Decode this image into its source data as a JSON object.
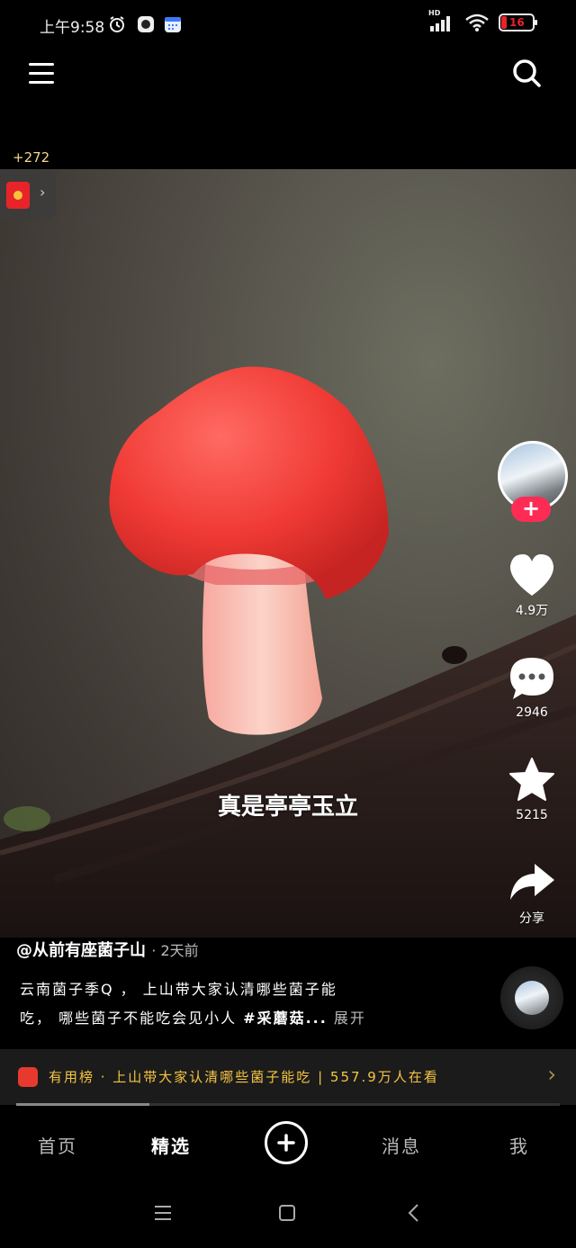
{
  "status_bar": {
    "time": "上午9:58",
    "network": "HD",
    "battery": "16",
    "icons": [
      "alarm-icon",
      "app-icon",
      "calendar-icon",
      "signal-icon",
      "wifi-icon",
      "battery-icon"
    ]
  },
  "top_nav": {
    "menu_icon": "menu-icon",
    "search_icon": "search-icon"
  },
  "coin_count": "+272",
  "video": {
    "subtitle": "真是亭亭玉立"
  },
  "actions": {
    "likes": "4.9万",
    "comments": "2946",
    "favorites": "5215",
    "share": "分享",
    "follow_label": "+"
  },
  "caption": {
    "author": "@从前有座菌子山",
    "time": "· 2天前",
    "desc_line1": "云南菌子季Q ， 上山带大家认清哪些菌子能",
    "desc_line2_text": "吃， 哪些菌子不能吃会见小人 ",
    "desc_tag": "#采蘑菇...",
    "desc_more": " 展开"
  },
  "hot_bar": {
    "text": "有用榜 · 上山带大家认清哪些菌子能吃 | 557.9万人在看"
  },
  "tabs": {
    "home": "首页",
    "featured": "精选",
    "messages": "消息",
    "me": "我"
  },
  "colors": {
    "accent": "#fe2c55",
    "hot_text": "#f5c542",
    "background": "#000000"
  }
}
